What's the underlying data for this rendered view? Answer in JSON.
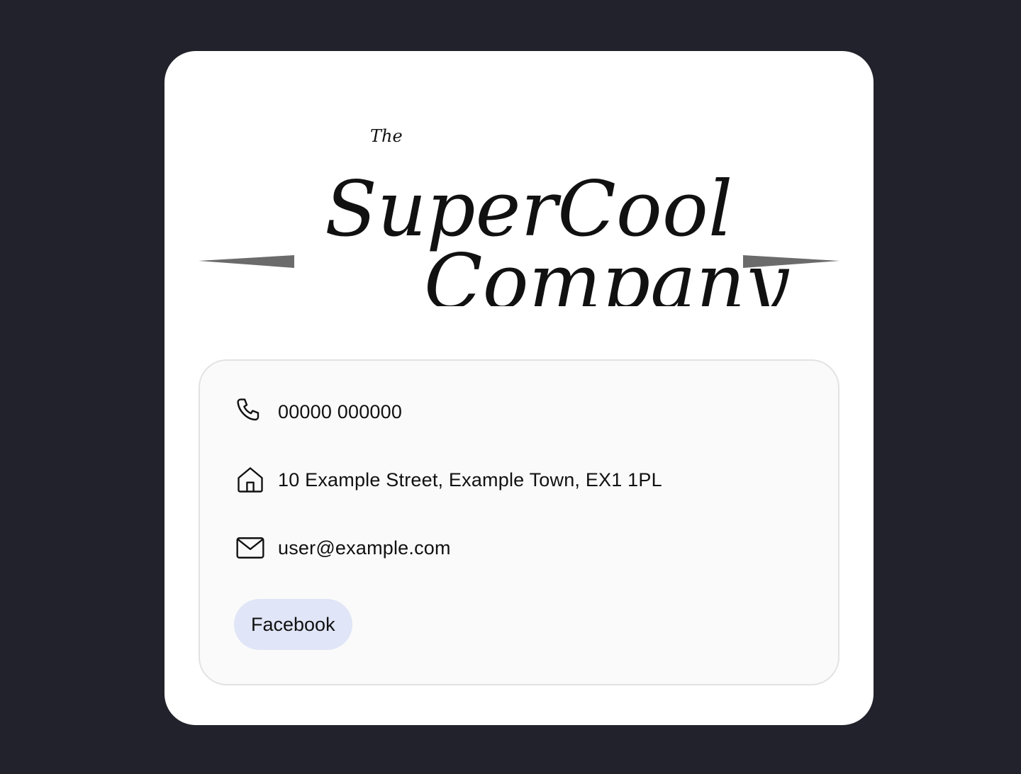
{
  "logo": {
    "small_text": "The",
    "line1": "SuperCool",
    "line2": "Company"
  },
  "contact": {
    "phone": "00000 000000",
    "address": "10 Example Street, Example Town, EX1 1PL",
    "email": "user@example.com",
    "social_label": "Facebook"
  },
  "icons": {
    "phone": "phone-icon",
    "address": "home-icon",
    "email": "mail-icon"
  },
  "colors": {
    "page_background": "#22222c",
    "card_background": "#ffffff",
    "panel_background": "#fafafa",
    "button_background": "#e0e5f7",
    "text": "#111111"
  }
}
